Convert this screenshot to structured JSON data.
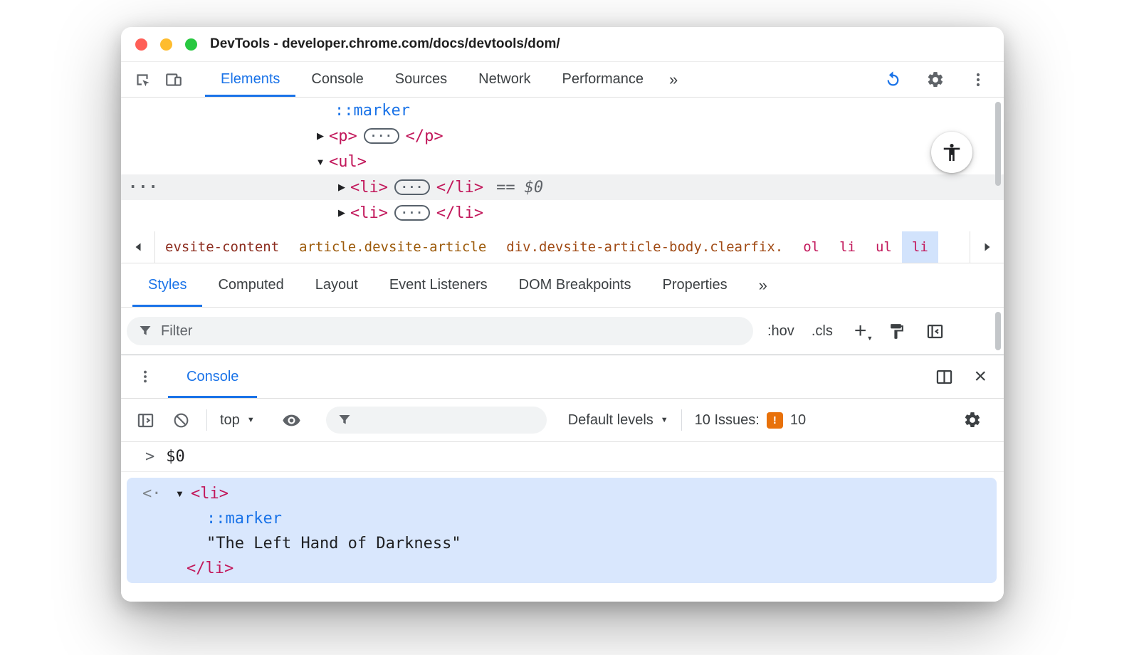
{
  "window": {
    "title": "DevTools - developer.chrome.com/docs/devtools/dom/"
  },
  "main_toolbar": {
    "tabs": [
      {
        "label": "Elements",
        "active": true
      },
      {
        "label": "Console",
        "active": false
      },
      {
        "label": "Sources",
        "active": false
      },
      {
        "label": "Network",
        "active": false
      },
      {
        "label": "Performance",
        "active": false
      }
    ],
    "more": "»"
  },
  "elements_tree": {
    "rows": [
      {
        "text": "::marker"
      },
      {
        "arrow": "▶",
        "open": "<p>",
        "ellipsis": "···",
        "close": "</p>"
      },
      {
        "arrow": "▼",
        "open": "<ul>"
      },
      {
        "arrow": "▶",
        "open": "<li>",
        "ellipsis": "···",
        "close": "</li>",
        "eq": "==",
        "ref": "$0",
        "gutter": "···",
        "selected": true
      },
      {
        "arrow": "▶",
        "open": "<li>",
        "ellipsis": "···",
        "close": "</li>"
      }
    ]
  },
  "breadcrumb": {
    "items": [
      {
        "label": "evsite-content"
      },
      {
        "label": "article.devsite-article"
      },
      {
        "label": "div.devsite-article-body.clearfix."
      },
      {
        "label": "ol"
      },
      {
        "label": "li"
      },
      {
        "label": "ul"
      },
      {
        "label": "li",
        "selected": true
      }
    ]
  },
  "sidebar_tabs": {
    "tabs": [
      {
        "label": "Styles",
        "active": true
      },
      {
        "label": "Computed",
        "active": false
      },
      {
        "label": "Layout",
        "active": false
      },
      {
        "label": "Event Listeners",
        "active": false
      },
      {
        "label": "DOM Breakpoints",
        "active": false
      },
      {
        "label": "Properties",
        "active": false
      }
    ],
    "more": "»"
  },
  "styles_toolbar": {
    "filter_placeholder": "Filter",
    "hov": ":hov",
    "cls": ".cls",
    "plus": "+"
  },
  "console": {
    "tab_label": "Console",
    "context_selector": "top",
    "levels_label": "Default levels",
    "issues_label": "10 Issues:",
    "issues_count": "10",
    "prompt_chevron": ">",
    "prompt_expr": "$0",
    "result": {
      "returned_marker": "<·",
      "arrow": "▼",
      "open": "<li>",
      "marker": "::marker",
      "string": "\"The Left Hand of Darkness\"",
      "close": "</li>"
    }
  },
  "colors": {
    "accent_blue": "#1a73e8",
    "tag_pink": "#c2185b",
    "pseudo_blue": "#1a73e8",
    "issues_orange": "#e8710a",
    "selection_blue": "#d2e3fc",
    "result_highlight": "#d9e7fd"
  },
  "icons": {
    "caret_down": "▼",
    "close": "×"
  }
}
